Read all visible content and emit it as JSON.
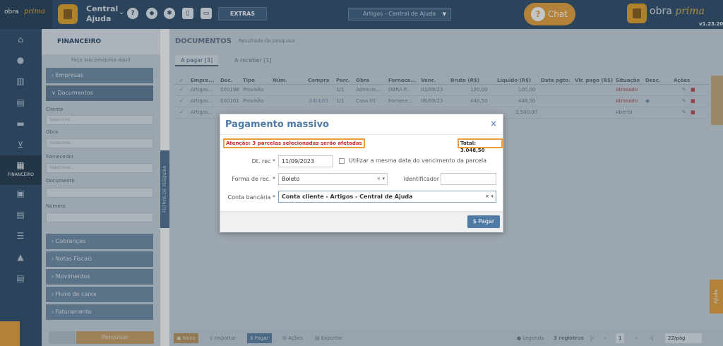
{
  "topbar": {
    "logo_text": "obra",
    "logo_script": "prima",
    "project_line1": "Central",
    "project_line2": "Ajuda",
    "extras": "EXTRAS",
    "context_select": "Artigos - Central de Ajuda",
    "chat": "Chat",
    "brand_main": "obra",
    "brand_script": "prima",
    "version": "v1.23.20"
  },
  "iconbar": {
    "active_label": "FINANCEIRO"
  },
  "sidebar": {
    "title": "FINANCEIRO",
    "hint": "Faça sua pesquisa aqui!",
    "sections": [
      {
        "label": "› Empresas"
      },
      {
        "label": "∨ Documentos"
      },
      {
        "label": "› Cobranças"
      },
      {
        "label": "› Notas Fiscais"
      },
      {
        "label": "› Movimentos"
      },
      {
        "label": "› Fluxo de caixa"
      },
      {
        "label": "› Faturamento"
      }
    ],
    "fields": [
      {
        "label": "Cliente",
        "placeholder": "Selecione..."
      },
      {
        "label": "Obra",
        "placeholder": "Selecione..."
      },
      {
        "label": "Fornecedor",
        "placeholder": "Selecione..."
      },
      {
        "label": "Documento",
        "placeholder": ""
      },
      {
        "label": "Número",
        "placeholder": ""
      }
    ],
    "search_button": "Pesquisar",
    "vertical_tab": "FILTROS DE PESQUISA"
  },
  "main": {
    "title": "DOCUMENTOS",
    "result_label": "Resultado da pesquisa",
    "tabs": [
      "A pagar [3]",
      "A receber [1]"
    ],
    "columns": [
      "Empre...",
      "Doc.",
      "Tipo",
      "Núm.",
      "Compra",
      "Parc.",
      "Obra",
      "Fornece...",
      "Venc.",
      "Bruto (R$)",
      "Líquido (R$)",
      "Data pgto.",
      "Vlr. pago (R$)",
      "Situação",
      "Desc.",
      "Ações"
    ],
    "rows": [
      {
        "empresa": "Artigos...",
        "doc": "000198",
        "tipo": "Provisão",
        "compra": "",
        "parc": "1/1",
        "obra": "Adminis...",
        "fornecedor": "OBRA P...",
        "venc": "03/09/23",
        "bruto": "100,00",
        "liquido": "100,00",
        "situacao": "Atrasado"
      },
      {
        "empresa": "Artigos...",
        "doc": "000201",
        "tipo": "Provisão",
        "compra": "000003",
        "parc": "1/1",
        "obra": "Casa 01",
        "fornecedor": "Fornece...",
        "venc": "06/09/23",
        "bruto": "448,50",
        "liquido": "448,50",
        "situacao": "Atrasado"
      },
      {
        "empresa": "Artigos...",
        "doc": "",
        "tipo": "",
        "compra": "",
        "parc": "",
        "obra": "",
        "fornecedor": "",
        "venc": "",
        "bruto": "",
        "liquido": "2.500,00",
        "situacao": "Aberto"
      }
    ],
    "bottom": {
      "new": "Novo",
      "import": "Importar",
      "pay": "Pagar",
      "actions": "Ações",
      "export": "Exportar",
      "legend": "Legenda",
      "records": "3 registros",
      "page": "1",
      "page_size": "22/pág"
    }
  },
  "ajuda": "Ajuda",
  "modal": {
    "title": "Pagamento massivo",
    "close": "×",
    "warning": "Atenção: 3 parcelas selecionadas serão afetadas",
    "total": "Total: 3.048,50",
    "dt_rec_label": "Dt. rec *",
    "dt_rec_value": "11/09/2023",
    "same_date_label": "Utilizar a mesma data do vencimento da parcela",
    "forma_label": "Forma de rec. *",
    "forma_value": "Boleto",
    "identificador_label": "Identificador",
    "identificador_value": "",
    "conta_label": "Conta bancária *",
    "conta_value": "Conta cliente - Artigos - Central de Ajuda",
    "pay_button": "$ Pagar"
  },
  "colors": {
    "topbar": "#2d4b67",
    "accent": "#e8a13a",
    "modal_title": "#4e7aa3",
    "warning": "#d22b2b"
  }
}
